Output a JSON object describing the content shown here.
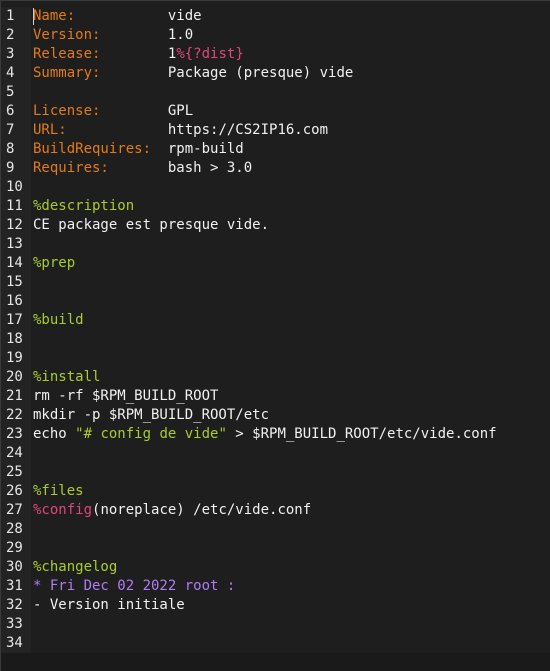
{
  "editor": {
    "line_numbers": [
      "1",
      "2",
      "3",
      "4",
      "5",
      "6",
      "7",
      "8",
      "9",
      "10",
      "11",
      "12",
      "13",
      "14",
      "15",
      "16",
      "17",
      "18",
      "19",
      "20",
      "21",
      "22",
      "23",
      "24",
      "25",
      "26",
      "27",
      "28",
      "29",
      "30",
      "31",
      "32",
      "33",
      "34"
    ],
    "lines": {
      "l1": {
        "tag": "Name:",
        "pad": "           ",
        "val": "vide"
      },
      "l2": {
        "tag": "Version:",
        "pad": "        ",
        "val": "1.0"
      },
      "l3": {
        "tag": "Release:",
        "pad": "        ",
        "val": "1",
        "macro": "%{?dist}"
      },
      "l4": {
        "tag": "Summary:",
        "pad": "        ",
        "val": "Package (presque) vide"
      },
      "l6": {
        "tag": "License:",
        "pad": "        ",
        "val": "GPL"
      },
      "l7": {
        "tag": "URL:",
        "pad": "            ",
        "val": "https://CS2IP16.com"
      },
      "l8": {
        "tag": "BuildRequires:",
        "pad": "  ",
        "val": "rpm-build"
      },
      "l9": {
        "tag": "Requires:",
        "pad": "       ",
        "val": "bash > 3.0"
      },
      "l11": {
        "section": "%description"
      },
      "l12": {
        "text": "CE package est presque vide."
      },
      "l14": {
        "section": "%prep"
      },
      "l17": {
        "section": "%build"
      },
      "l20": {
        "section": "%install"
      },
      "l21": {
        "text": "rm -rf $RPM_BUILD_ROOT"
      },
      "l22": {
        "text": "mkdir -p $RPM_BUILD_ROOT/etc"
      },
      "l23": {
        "pre": "echo ",
        "str": "\"# config de vide\"",
        "post": " > $RPM_BUILD_ROOT/etc/vide.conf"
      },
      "l26": {
        "section": "%files"
      },
      "l27": {
        "macro": "%config",
        "text": "(noreplace) /etc/vide.conf"
      },
      "l30": {
        "section": "%changelog"
      },
      "l31": {
        "text": "* Fri Dec 02 2022 root :"
      },
      "l32": {
        "text": "- Version initiale"
      }
    }
  },
  "colors": {
    "background": "#1e1e1e",
    "tag": "#e27b1a",
    "macro": "#e0467a",
    "section": "#a9cc2d",
    "changelog": "#b07cf0",
    "text": "#f0f0f0"
  }
}
